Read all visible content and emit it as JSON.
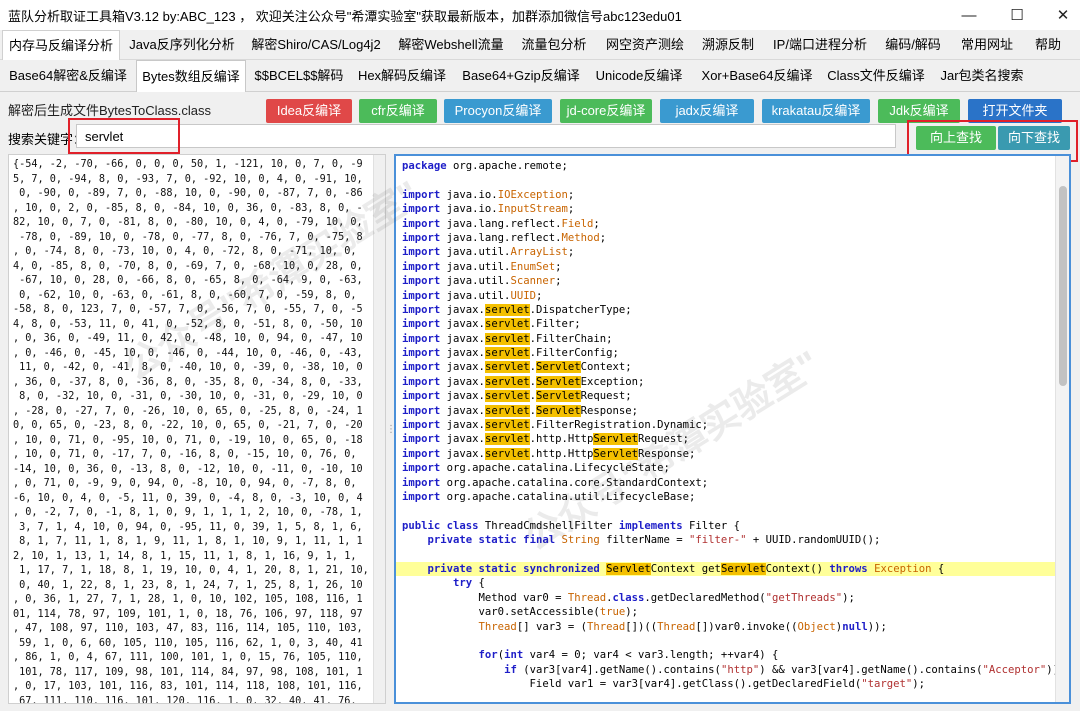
{
  "window": {
    "title": "蓝队分析取证工具箱V3.12 by:ABC_123 ， 欢迎关注公众号\"希潭实验室\"获取最新版本，加群添加微信号abc123edu01",
    "minimize": "—",
    "maximize": "☐",
    "close": "✕"
  },
  "menu": [
    "内存马反编译分析",
    "Java反序列化分析",
    "解密Shiro/CAS/Log4j2",
    "解密Webshell流量",
    "流量包分析",
    "网空资产测绘",
    "溯源反制",
    "IP/端口进程分析",
    "编码/解码",
    "常用网址",
    "帮助"
  ],
  "subtabs": [
    "Base64解密&反编译",
    "Bytes数组反编译",
    "$$BCEL$$解码",
    "Hex解码反编译",
    "Base64+Gzip反编译",
    "Unicode反编译",
    "Xor+Base64反编译",
    "Class文件反编译",
    "Jar包类名搜索"
  ],
  "toolbar": {
    "label": "解密后生成文件BytesToClass.class",
    "buttons": [
      "Idea反编译",
      "cfr反编译",
      "Procyon反编译",
      "jd-core反编译",
      "jadx反编译",
      "krakatau反编译",
      "Jdk反编译",
      "打开文件夹"
    ]
  },
  "search": {
    "label": "搜索关键字：",
    "value": "servlet",
    "up": "向上查找",
    "down": "向下查找"
  },
  "bytes_text": "{-54, -2, -70, -66, 0, 0, 0, 50, 1, -121, 10, 0, 7, 0, -9\n5, 7, 0, -94, 8, 0, -93, 7, 0, -92, 10, 0, 4, 0, -91, 10,\n 0, -90, 0, -89, 7, 0, -88, 10, 0, -90, 0, -87, 7, 0, -86\n, 10, 0, 2, 0, -85, 8, 0, -84, 10, 0, 36, 0, -83, 8, 0, -\n82, 10, 0, 7, 0, -81, 8, 0, -80, 10, 0, 4, 0, -79, 10, 0,\n -78, 0, -89, 10, 0, -78, 0, -77, 8, 0, -76, 7, 0, -75, 8\n, 0, -74, 8, 0, -73, 10, 0, 4, 0, -72, 8, 0, -71, 10, 0,\n4, 0, -85, 8, 0, -70, 8, 0, -69, 7, 0, -68, 10, 0, 28, 0,\n -67, 10, 0, 28, 0, -66, 8, 0, -65, 8, 0, -64, 9, 0, -63,\n 0, -62, 10, 0, -63, 0, -61, 8, 0, -60, 7, 0, -59, 8, 0,\n-58, 8, 0, 123, 7, 0, -57, 7, 0, -56, 7, 0, -55, 7, 0, -5\n4, 8, 0, -53, 11, 0, 41, 0, -52, 8, 0, -51, 8, 0, -50, 10\n, 0, 36, 0, -49, 11, 0, 42, 0, -48, 10, 0, 94, 0, -47, 10\n, 0, -46, 0, -45, 10, 0, -46, 0, -44, 10, 0, -46, 0, -43,\n 11, 0, -42, 0, -41, 8, 0, -40, 10, 0, -39, 0, -38, 10, 0\n, 36, 0, -37, 8, 0, -36, 8, 0, -35, 8, 0, -34, 8, 0, -33,\n 8, 0, -32, 10, 0, -31, 0, -30, 10, 0, -31, 0, -29, 10, 0\n, -28, 0, -27, 7, 0, -26, 10, 0, 65, 0, -25, 8, 0, -24, 1\n0, 0, 65, 0, -23, 8, 0, -22, 10, 0, 65, 0, -21, 7, 0, -20\n, 10, 0, 71, 0, -95, 10, 0, 71, 0, -19, 10, 0, 65, 0, -18\n, 10, 0, 71, 0, -17, 7, 0, -16, 8, 0, -15, 10, 0, 76, 0,\n-14, 10, 0, 36, 0, -13, 8, 0, -12, 10, 0, -11, 0, -10, 10\n, 0, 71, 0, -9, 9, 0, 94, 0, -8, 10, 0, 94, 0, -7, 8, 0,\n-6, 10, 0, 4, 0, -5, 11, 0, 39, 0, -4, 8, 0, -3, 10, 0, 4\n, 0, -2, 7, 0, -1, 8, 1, 0, 9, 1, 1, 1, 2, 10, 0, -78, 1,\n 3, 7, 1, 4, 10, 0, 94, 0, -95, 11, 0, 39, 1, 5, 8, 1, 6,\n 8, 1, 7, 11, 1, 8, 1, 9, 11, 1, 8, 1, 10, 9, 1, 11, 1, 1\n2, 10, 1, 13, 1, 14, 8, 1, 15, 11, 1, 8, 1, 16, 9, 1, 1,\n 1, 17, 7, 1, 18, 8, 1, 19, 10, 0, 4, 1, 20, 8, 1, 21, 10,\n 0, 40, 1, 22, 8, 1, 23, 8, 1, 24, 7, 1, 25, 8, 1, 26, 10\n, 0, 36, 1, 27, 7, 1, 28, 1, 0, 10, 102, 105, 108, 116, 1\n01, 114, 78, 97, 109, 101, 1, 0, 18, 76, 106, 97, 118, 97\n, 47, 108, 97, 110, 103, 47, 83, 116, 114, 105, 110, 103,\n 59, 1, 0, 6, 60, 105, 110, 105, 116, 62, 1, 0, 3, 40, 41\n, 86, 1, 0, 4, 67, 111, 100, 101, 1, 0, 15, 76, 105, 110,\n 101, 78, 117, 109, 98, 101, 114, 84, 97, 98, 108, 101, 1\n, 0, 17, 103, 101, 116, 83, 101, 114, 118, 108, 101, 116,\n 67, 111, 110, 116, 101, 120, 116, 1, 0, 32, 40, 41, 76,",
  "code": {
    "package": "org.apache.remote",
    "imports": [
      [
        "java.io.",
        "",
        "IOException"
      ],
      [
        "java.io.",
        "",
        "InputStream"
      ],
      [
        "java.lang.reflect.",
        "",
        "Field"
      ],
      [
        "java.lang.reflect.",
        "",
        "Method"
      ],
      [
        "java.util.",
        "",
        "ArrayList"
      ],
      [
        "java.util.",
        "",
        "EnumSet"
      ],
      [
        "java.util.",
        "",
        "Scanner"
      ],
      [
        "java.util.",
        "",
        "UUID"
      ],
      [
        "javax.",
        "servlet",
        ".DispatcherType"
      ],
      [
        "javax.",
        "servlet",
        ".Filter"
      ],
      [
        "javax.",
        "servlet",
        ".FilterChain"
      ],
      [
        "javax.",
        "servlet",
        ".FilterConfig"
      ],
      [
        "javax.",
        "servlet",
        ".ServletContext"
      ],
      [
        "javax.",
        "servlet",
        ".ServletException"
      ],
      [
        "javax.",
        "servlet",
        ".ServletRequest"
      ],
      [
        "javax.",
        "servlet",
        ".ServletResponse"
      ],
      [
        "javax.",
        "servlet",
        ".FilterRegistration.Dynamic"
      ],
      [
        "javax.",
        "servlet",
        ".http.HttpServletRequest"
      ],
      [
        "javax.",
        "servlet",
        ".http.HttpServletResponse"
      ],
      [
        "org.apache.catalina.LifecycleState",
        "",
        ""
      ],
      [
        "org.apache.catalina.core.StandardContext",
        "",
        ""
      ],
      [
        "org.apache.catalina.util.LifecycleBase",
        "",
        ""
      ]
    ],
    "class_decl": "ThreadCmdshellFilter",
    "iface": "Filter",
    "field_name": "filterName",
    "field_value": "\"filter-\"",
    "uuid_call": "UUID.randomUUID();",
    "method_line_name": "getServletContext",
    "throws": "Exception",
    "l1_str": "\"getThreads\"",
    "l2": "var0.setAccessible(true);",
    "l5_http": "\"http\"",
    "l5_acceptor": "\"Acceptor\"",
    "l6_target": "\"target\""
  }
}
